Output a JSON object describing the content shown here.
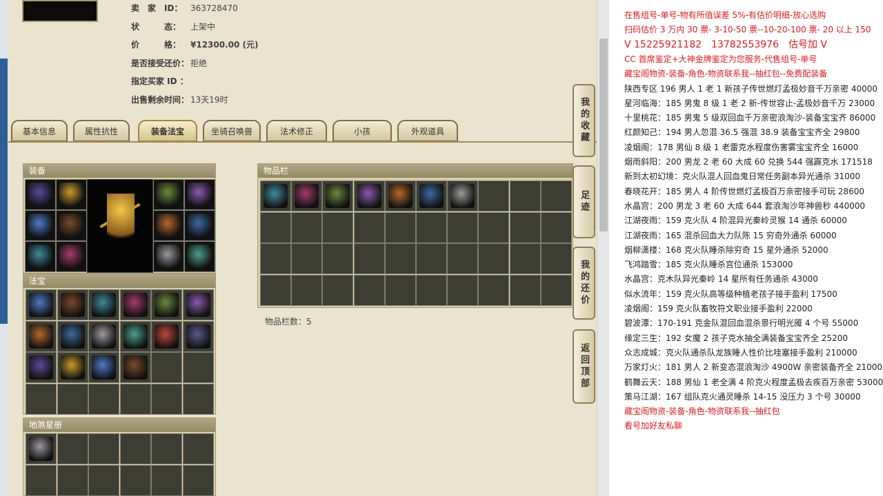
{
  "seller_info": [
    {
      "label": "卖　家　ID：",
      "value": "363728470"
    },
    {
      "label": "状　　　态：",
      "value": "上架中"
    },
    {
      "label": "价　　　格：",
      "value": "¥12300.00 (元)"
    },
    {
      "label": "是否接受还价：",
      "value": "拒绝"
    },
    {
      "label": "指定买家 ID ：",
      "value": ""
    },
    {
      "label": "出售剩余时间：",
      "value": "13天19时"
    }
  ],
  "tabs": [
    "基本信息",
    "属性抗性",
    "装备法宝",
    "坐骑召唤兽",
    "法术修正",
    "小孩",
    "外观道具"
  ],
  "active_tab": "装备法宝",
  "panels": {
    "equip_title": "装备",
    "fabao_title": "法宝",
    "star_title": "地煞星册",
    "items_title": "物品栏",
    "items_count_label": "物品栏数：5"
  },
  "side_buttons": [
    "我的收藏",
    "足迹",
    "我的还价",
    "返回顶部"
  ],
  "doc_lines": [
    {
      "text": "在售组号-单号-物有所值误差 5%-有估价明细-放心选购",
      "style": "red"
    },
    {
      "text": "扫码估价 3 万内 30 票- 3-10-50 票--10-20-100 票- 20 以上 150",
      "style": "red"
    },
    {
      "text": "V 15225921182　13782553976　估号加 V",
      "style": "red big"
    },
    {
      "text": "CC 首席鉴定+大神金牌鉴定为您服务-代售组号-单号",
      "style": "red"
    },
    {
      "text": "藏宝阁物资-装备-角色-物资联系我--抽红包--免费配装备",
      "style": "red"
    },
    {
      "text": "陕西专区 196 男人 1 老 1 新孩子传世燃灯孟极妙音千万亲密 40000",
      "style": ""
    },
    {
      "text": "星河临海：185 男鬼 8 级 1 老 2 新-传世容止-孟极妙音千万 23000",
      "style": ""
    },
    {
      "text": "十里桃花：185 男鬼 5 级双回血千万亲密浪淘沙-装备宝宝齐 86000",
      "style": ""
    },
    {
      "text": "红颜知己：194 男人忽混 36.5 强混 38.9 装备宝宝齐全 29800",
      "style": ""
    },
    {
      "text": "凌烟阁：178 男仙 8 级 1 老雷克水程度伤害雾宝宝齐全 16000",
      "style": ""
    },
    {
      "text": "烟雨斜阳：200 男龙 2 老 60 大成 60 兑换 544 强霹克水 171518",
      "style": ""
    },
    {
      "text": "新到太初幻境：克火队混人回血鬼日常任务副本异光通杀 31000",
      "style": ""
    },
    {
      "text": "春晓花开：185 男人 4 阶传世燃灯孟极百万亲密接手可玩 28600",
      "style": ""
    },
    {
      "text": "水晶宫：200 男龙 3 老 60 大成 644 套浪淘沙年神兽秒 440000",
      "style": ""
    },
    {
      "text": "江湖夜雨：159 克火队 4 阶混异光秦岭灵猴 14 通杀 60000",
      "style": ""
    },
    {
      "text": "江湖夜雨：165 混杀回血大力队陈 15 穷奇外通杀 60000",
      "style": ""
    },
    {
      "text": "烟柳潇楼：168 克火队睡杀除穷奇 15 星外通杀 52000",
      "style": ""
    },
    {
      "text": "飞鸿踏雪：185 克火队睡杀宫位通杀 153000",
      "style": ""
    },
    {
      "text": "水晶宫：克木队异光秦岭 14 星所有任务通杀 43000",
      "style": ""
    },
    {
      "text": "似水流年：159 克火队高等级种植老孩子接手盈利 17500",
      "style": ""
    },
    {
      "text": "凌烟阁：159 克火队畜牧符文职业接手盈利 22000",
      "style": ""
    },
    {
      "text": "碧波潭：170-191 克金队混回血混杀景行明光魇 4 个号 55000",
      "style": ""
    },
    {
      "text": "缘定三生：192 女魔 2 孩子克水抽全满装备宝宝齐全 25200",
      "style": ""
    },
    {
      "text": "众志成城：克火队通杀队龙族睡人性价比哇塞接手盈利 210000",
      "style": ""
    },
    {
      "text": "万家灯火：181 男人 2 新变态混浪淘沙 4900W 亲密装备齐全 210000",
      "style": ""
    },
    {
      "text": "鹤舞云天：188 男仙 1 老全满 4 阶克火程度孟极去疾百万亲密 53000",
      "style": ""
    },
    {
      "text": "策马江湖：167 组队克火通灵睡杀 14-15 没压力 3 个号 30000",
      "style": ""
    },
    {
      "text": "藏宝阁物资-装备-角色-物资联系我--抽红包",
      "style": "red"
    },
    {
      "text": "看号加好友私聊",
      "style": "red"
    }
  ],
  "colors": {
    "price_red": "#d21a1a",
    "doc_red": "#e01a1a",
    "game_bg": "#eae3cd",
    "panel_header": "#958962"
  }
}
